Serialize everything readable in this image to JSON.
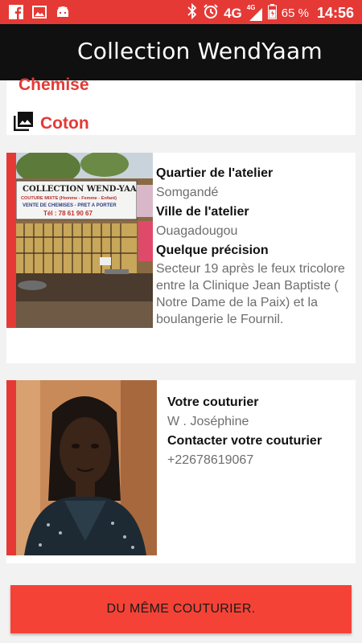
{
  "status_bar": {
    "network": "4G",
    "network_small": "4G",
    "battery": "65 %",
    "time": "14:56"
  },
  "toolbar": {
    "title": "Collection WendYaam"
  },
  "product": {
    "category": "Chemise",
    "fabric": "Coton"
  },
  "atelier": {
    "sign_line1": "COLLECTION WEND-YAAM",
    "sign_line2": "COUTURE MIXTE (Homme - Femme - Enfant)",
    "sign_line3": "VENTE DE CHEMISES - PRET A PORTER",
    "sign_line4": "Tél : 78 61 90 67",
    "quarter_label": "Quartier de l'atelier",
    "quarter_value": "Somgandé",
    "city_label": "Ville de l'atelier",
    "city_value": "Ouagadougou",
    "precision_label": "Quelque précision",
    "precision_value": "Secteur 19 après le feux tricolore entre la Clinique Jean Baptiste ( Notre Dame de la Paix) et la boulangerie le Fournil."
  },
  "tailor": {
    "name_label": "Votre couturier",
    "name_value": "W . Joséphine",
    "contact_label": "Contacter votre couturier",
    "contact_value": "+22678619067"
  },
  "cta": {
    "label": "DU MÊME COUTURIER."
  },
  "colors": {
    "accent": "#e53935",
    "toolbar": "#101010",
    "cta": "#f44336"
  },
  "icons": [
    "facebook-icon",
    "image-icon",
    "android-icon",
    "bluetooth-icon",
    "alarm-icon",
    "signal-icon",
    "battery-icon",
    "gallery-icon"
  ]
}
